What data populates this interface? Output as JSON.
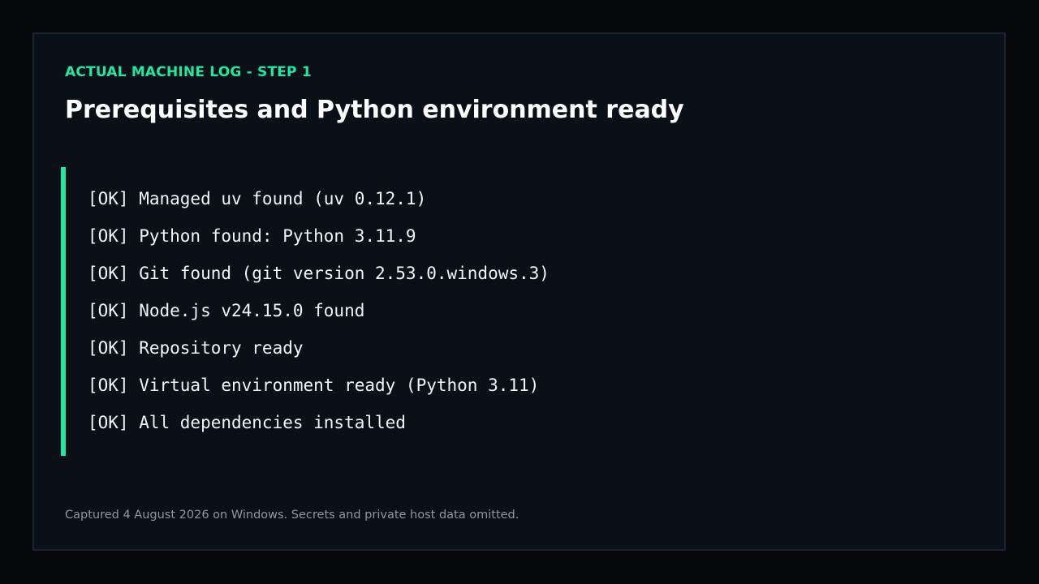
{
  "header": {
    "eyebrow": "ACTUAL MACHINE LOG - STEP 1",
    "title": "Prerequisites and Python environment ready"
  },
  "log": {
    "lines": [
      "[OK] Managed uv found (uv 0.12.1)",
      "[OK] Python found: Python 3.11.9",
      "[OK] Git found (git version 2.53.0.windows.3)",
      "[OK] Node.js v24.15.0 found",
      "[OK] Repository ready",
      "[OK] Virtual environment ready (Python 3.11)",
      "[OK] All dependencies installed"
    ]
  },
  "footer": {
    "note": "Captured 4 August 2026 on Windows. Secrets and private host data omitted."
  },
  "colors": {
    "accent": "#1de9a0",
    "background": "#0b0f17",
    "text": "#f2f4f8",
    "muted": "#8d95a6"
  }
}
